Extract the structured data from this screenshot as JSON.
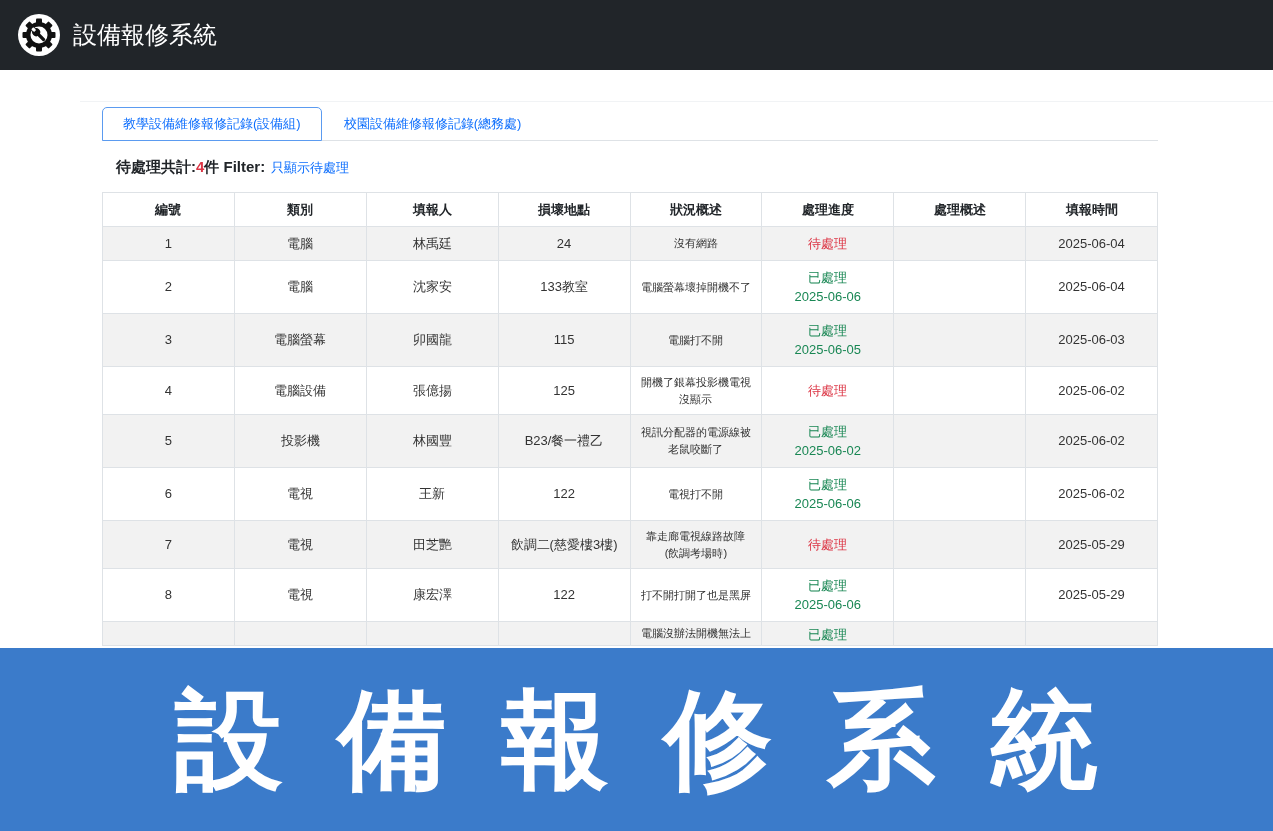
{
  "header": {
    "title": "設備報修系統"
  },
  "tabs": [
    {
      "label": "教學設備維修報修記錄(設備組)",
      "selected": true
    },
    {
      "label": "校園設備維修報修記錄(總務處)",
      "selected": false
    }
  ],
  "summary": {
    "label": "待處理共計:",
    "count": "4",
    "unit": "件 Filter:",
    "filter_link": "只顯示待處理"
  },
  "table": {
    "columns": [
      "編號",
      "類別",
      "填報人",
      "損壞地點",
      "狀況概述",
      "處理進度",
      "處理概述",
      "填報時間"
    ],
    "rows": [
      {
        "no": "1",
        "category": "電腦",
        "reporter": "林禹廷",
        "location": "24",
        "description": "沒有網路",
        "status": {
          "kind": "pending",
          "label": "待處理"
        },
        "date": "2025-06-04"
      },
      {
        "no": "2",
        "category": "電腦",
        "reporter": "沈家安",
        "location": "133教室",
        "description": "電腦螢幕壞掉開機不了",
        "status": {
          "kind": "done",
          "label": "已處理",
          "date": "2025-06-06"
        },
        "date": "2025-06-04"
      },
      {
        "no": "3",
        "category": "電腦螢幕",
        "reporter": "卯國龍",
        "location": "115",
        "description": "電腦打不開",
        "status": {
          "kind": "done",
          "label": "已處理",
          "date": "2025-06-05"
        },
        "date": "2025-06-03"
      },
      {
        "no": "4",
        "category": "電腦設備",
        "reporter": "張億揚",
        "location": "125",
        "description": "開機了銀幕投影機電視沒顯示",
        "status": {
          "kind": "pending",
          "label": "待處理"
        },
        "date": "2025-06-02"
      },
      {
        "no": "5",
        "category": "投影機",
        "reporter": "林國豐",
        "location": "B23/餐一禮乙",
        "description": "視訊分配器的電源線被老鼠咬斷了",
        "status": {
          "kind": "done",
          "label": "已處理",
          "date": "2025-06-02"
        },
        "date": "2025-06-02"
      },
      {
        "no": "6",
        "category": "電視",
        "reporter": "王新",
        "location": "122",
        "description": "電視打不開",
        "status": {
          "kind": "done",
          "label": "已處理",
          "date": "2025-06-06"
        },
        "date": "2025-06-02"
      },
      {
        "no": "7",
        "category": "電視",
        "reporter": "田芝艷",
        "location": "飲調二(慈愛樓3樓)",
        "description": "靠走廊電視線路故障(飲調考場時)",
        "status": {
          "kind": "pending",
          "label": "待處理"
        },
        "date": "2025-05-29"
      },
      {
        "no": "8",
        "category": "電視",
        "reporter": "康宏澤",
        "location": "122",
        "description": "打不開打開了也是黑屏",
        "status": {
          "kind": "done",
          "label": "已處理",
          "date": "2025-06-06"
        },
        "date": "2025-05-29"
      },
      {
        "description": "電腦沒辦法開機無法上",
        "status": {
          "kind": "done",
          "label": "已處理"
        }
      }
    ]
  },
  "banner": {
    "title": "設備報修系統"
  }
}
